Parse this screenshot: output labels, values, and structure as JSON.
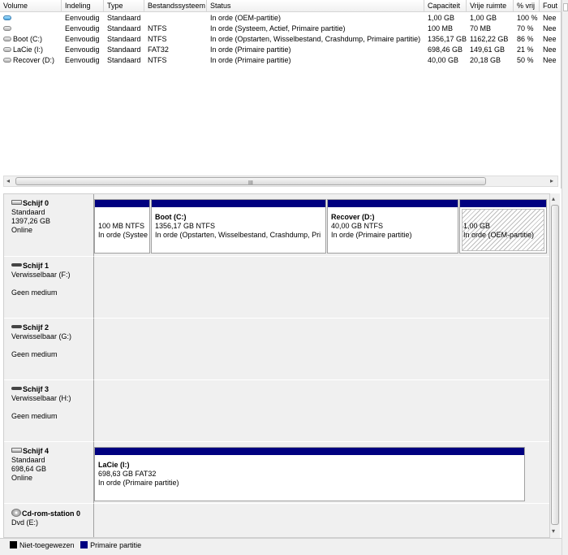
{
  "volume_table": {
    "columns": [
      "Volume",
      "Indeling",
      "Type",
      "Bestandssysteem",
      "Status",
      "Capaciteit",
      "Vrije ruimte",
      "% vrij",
      "Fout"
    ],
    "rows": [
      {
        "icon": "volume-oem-icon",
        "volume": "",
        "indeling": "Eenvoudig",
        "type": "Standaard",
        "fs": "",
        "status": "In orde (OEM-partitie)",
        "cap": "1,00 GB",
        "free": "1,00 GB",
        "pct": "100 %",
        "fault": "Nee"
      },
      {
        "icon": "volume-drive-icon",
        "volume": "",
        "indeling": "Eenvoudig",
        "type": "Standaard",
        "fs": "NTFS",
        "status": "In orde (Systeem, Actief, Primaire partitie)",
        "cap": "100 MB",
        "free": "70 MB",
        "pct": "70 %",
        "fault": "Nee"
      },
      {
        "icon": "volume-drive-icon",
        "volume": "Boot (C:)",
        "indeling": "Eenvoudig",
        "type": "Standaard",
        "fs": "NTFS",
        "status": "In orde (Opstarten, Wisselbestand, Crashdump, Primaire partitie)",
        "cap": "1356,17 GB",
        "free": "1162,22 GB",
        "pct": "86 %",
        "fault": "Nee"
      },
      {
        "icon": "volume-drive-icon",
        "volume": "LaCie (I:)",
        "indeling": "Eenvoudig",
        "type": "Standaard",
        "fs": "FAT32",
        "status": "In orde (Primaire partitie)",
        "cap": "698,46 GB",
        "free": "149,61 GB",
        "pct": "21 %",
        "fault": "Nee"
      },
      {
        "icon": "volume-drive-icon",
        "volume": "Recover (D:)",
        "indeling": "Eenvoudig",
        "type": "Standaard",
        "fs": "NTFS",
        "status": "In orde (Primaire partitie)",
        "cap": "40,00 GB",
        "free": "20,18 GB",
        "pct": "50 %",
        "fault": "Nee"
      }
    ],
    "scroll_grip": "III"
  },
  "disks": [
    {
      "name": "Schijf 0",
      "line1": "Standaard",
      "line2": "1397,26 GB",
      "line3": "Online",
      "icon": "hard-disk-icon",
      "partitions": [
        {
          "title": "",
          "size": "100 MB NTFS",
          "status": "In orde (Systee"
        },
        {
          "title": "Boot  (C:)",
          "size": "1356,17 GB NTFS",
          "status": "In orde (Opstarten, Wisselbestand, Crashdump, Pri"
        },
        {
          "title": "Recover  (D:)",
          "size": "40,00 GB NTFS",
          "status": "In orde (Primaire partitie)"
        },
        {
          "title": "",
          "size": "1,00 GB",
          "status": "In orde (OEM-partitie)",
          "hatched": true
        }
      ]
    },
    {
      "name": "Schijf 1",
      "line1": "Verwisselbaar (F:)",
      "line2": "",
      "line3": "Geen medium",
      "icon": "removable-disk-icon",
      "partitions": []
    },
    {
      "name": "Schijf 2",
      "line1": "Verwisselbaar (G:)",
      "line2": "",
      "line3": "Geen medium",
      "icon": "removable-disk-icon",
      "partitions": []
    },
    {
      "name": "Schijf 3",
      "line1": "Verwisselbaar (H:)",
      "line2": "",
      "line3": "Geen medium",
      "icon": "removable-disk-icon",
      "partitions": []
    },
    {
      "name": "Schijf 4",
      "line1": "Standaard",
      "line2": "698,64 GB",
      "line3": "Online",
      "icon": "hard-disk-icon",
      "partitions": [
        {
          "title": "LaCie  (I:)",
          "size": "698,63 GB FAT32",
          "status": "In orde (Primaire partitie)"
        }
      ]
    },
    {
      "name": "Cd-rom-station 0",
      "line1": "Dvd (E:)",
      "line2": "",
      "line3": "",
      "icon": "cd-rom-icon",
      "partitions": []
    }
  ],
  "legend": {
    "unallocated": {
      "label": "Niet-toegewezen",
      "color": "#000000"
    },
    "primary": {
      "label": "Primaire partitie",
      "color": "#000080"
    }
  }
}
